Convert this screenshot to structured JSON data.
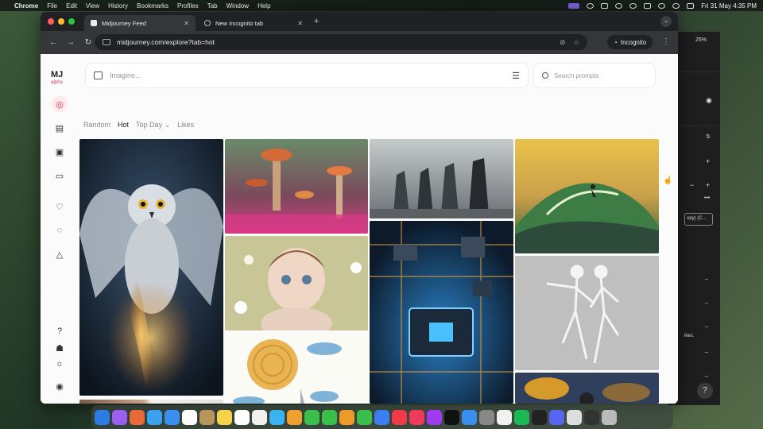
{
  "menubar": {
    "app": "Chrome",
    "items": [
      "File",
      "Edit",
      "View",
      "History",
      "Bookmarks",
      "Profiles",
      "Tab",
      "Window",
      "Help"
    ],
    "clock": "Fri 31 May  4:35 PM"
  },
  "browser": {
    "tabs": [
      {
        "label": "Midjourney Feed",
        "active": true
      },
      {
        "label": "New Incognito tab",
        "active": false
      }
    ],
    "url": "midjourney.com/explore?tab=hot",
    "incognito_label": "Incognito"
  },
  "background_app": {
    "zoom": "25%",
    "copy_button": "opy) (C...",
    "fragment": "ikes."
  },
  "midjourney": {
    "logo": "MJ",
    "logo_sub": "alpha",
    "imagine_placeholder": "Imagine...",
    "search_placeholder": "Search prompts",
    "filters": {
      "random": "Random",
      "hot": "Hot",
      "top_day": "Top Day",
      "likes": "Likes"
    },
    "sidebar_icons": [
      "explore-icon",
      "create-icon",
      "organize-icon",
      "chat-icon",
      "likes-icon",
      "ideas-icon",
      "notifications-icon",
      "help-icon",
      "updates-icon",
      "theme-icon",
      "account-icon"
    ]
  },
  "images": [
    {
      "name": "owl-image",
      "colors": [
        "#1d2c3c",
        "#7e8da0",
        "#e4a046"
      ]
    },
    {
      "name": "mushroom-image",
      "colors": [
        "#5a3a2a",
        "#d36a3a",
        "#d63b85"
      ]
    },
    {
      "name": "child-image",
      "colors": [
        "#cfa88d",
        "#f0d6c4",
        "#b9c78b"
      ]
    },
    {
      "name": "sun-doodle-image",
      "colors": [
        "#fbfbf6",
        "#e9b453",
        "#7fb3d7"
      ]
    },
    {
      "name": "monoliths-image",
      "colors": [
        "#8c9396",
        "#3b4045",
        "#c7cbcc"
      ]
    },
    {
      "name": "circuit-chip-image",
      "colors": [
        "#0c1a2a",
        "#2a7fc4",
        "#e8a040"
      ]
    },
    {
      "name": "surfer-wave-image",
      "colors": [
        "#e9c24b",
        "#3e7c46",
        "#2e5a3a"
      ]
    },
    {
      "name": "skeletons-image",
      "colors": [
        "#d6d6d6",
        "#8a8a8a",
        "#eeeeee"
      ]
    },
    {
      "name": "autumn-image",
      "colors": [
        "#2f3f5c",
        "#d69a2a",
        "#8a6a3a"
      ]
    },
    {
      "name": "portrait-strip-image",
      "colors": [
        "#8a6a5a",
        "#c9a38a",
        "#f1f1ee"
      ]
    }
  ]
}
